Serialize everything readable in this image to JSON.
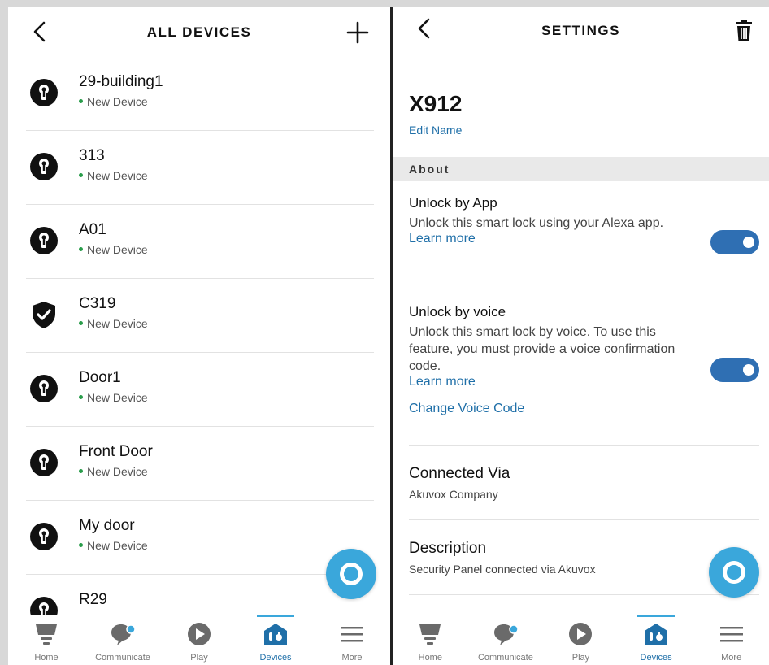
{
  "left": {
    "header": {
      "title": "ALL DEVICES"
    },
    "devices": [
      {
        "name": "29-building1",
        "status": "New Device",
        "icon": "keyhole-icon"
      },
      {
        "name": "313",
        "status": "New Device",
        "icon": "keyhole-icon"
      },
      {
        "name": "A01",
        "status": "New Device",
        "icon": "keyhole-icon"
      },
      {
        "name": "C319",
        "status": "New Device",
        "icon": "shield-check-icon"
      },
      {
        "name": "Door1",
        "status": "New Device",
        "icon": "keyhole-icon"
      },
      {
        "name": "Front Door",
        "status": "New Device",
        "icon": "keyhole-icon"
      },
      {
        "name": "My door",
        "status": "New Device",
        "icon": "keyhole-icon"
      },
      {
        "name": "R29",
        "status": "",
        "icon": "keyhole-icon"
      }
    ]
  },
  "right": {
    "header": {
      "title": "SETTINGS"
    },
    "device_name": "X912",
    "edit_name": "Edit Name",
    "section_about": "About",
    "unlock_app": {
      "title": "Unlock by App",
      "description": "Unlock this smart lock using your Alexa app.",
      "link": "Learn more",
      "enabled": true
    },
    "unlock_voice": {
      "title": "Unlock by voice",
      "description": "Unlock this smart lock by voice. To use this feature, you must provide a voice confirmation code.",
      "link": "Learn more",
      "change_code": "Change Voice Code",
      "enabled": true
    },
    "connected_via": {
      "title": "Connected Via",
      "value": "Akuvox Company"
    },
    "description": {
      "title": "Description",
      "value": "Security Panel connected via Akuvox"
    }
  },
  "nav": {
    "items": [
      {
        "label": "Home",
        "icon": "home-icon"
      },
      {
        "label": "Communicate",
        "icon": "communicate-icon"
      },
      {
        "label": "Play",
        "icon": "play-icon"
      },
      {
        "label": "Devices",
        "icon": "devices-icon",
        "active": true
      },
      {
        "label": "More",
        "icon": "more-icon"
      }
    ]
  },
  "colors": {
    "accent": "#3aa7db",
    "link": "#1f6fa8",
    "toggle_on": "#2f6fb3",
    "status_dot": "#2a9d4b"
  }
}
